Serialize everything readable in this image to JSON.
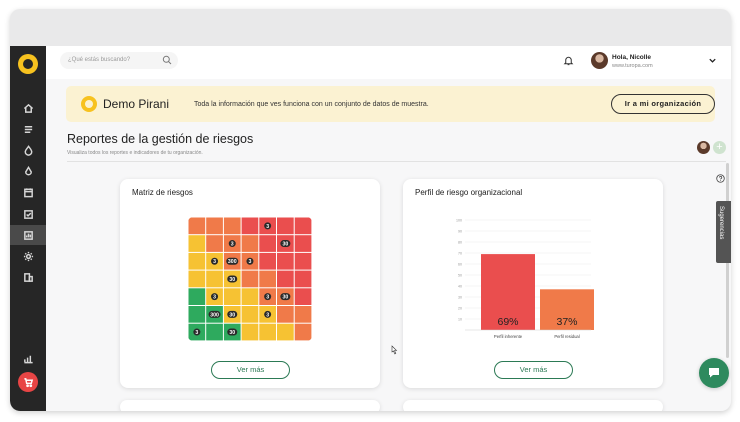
{
  "sidebar": {
    "items": [
      "home-icon",
      "list-icon",
      "flame-icon",
      "drop-icon",
      "calendar-icon",
      "check-icon",
      "reports-icon",
      "gear-icon",
      "building-icon"
    ],
    "bottom": [
      "chart-growth-icon",
      "cart-icon"
    ]
  },
  "search": {
    "placeholder": "¿Qué estás buscando?"
  },
  "user": {
    "greeting": "Hola, Nicolle",
    "site": "www.turopa.com"
  },
  "banner": {
    "name": "Demo Pirani",
    "message": "Toda la información que ves funciona con un conjunto de datos de muestra.",
    "button": "Ir a mi organización"
  },
  "page": {
    "title": "Reportes de la gestión de riesgos",
    "subtitle": "Visualiza todos los reportes e indicadores de tu organización."
  },
  "cards": {
    "matrix": {
      "title": "Matriz de riesgos",
      "button": "Ver más"
    },
    "profile": {
      "title": "Perfil de riesgo organizacional",
      "button": "Ver más"
    }
  },
  "side_tab": {
    "label": "Sugerencias"
  },
  "colors": {
    "green": "#2eaa5e",
    "yellow": "#f6c233",
    "orange": "#f07a49",
    "red": "#ea4e4e",
    "accent": "#2c7a55"
  },
  "matrix": {
    "rows": [
      [
        "orange",
        "orange",
        "orange",
        "red",
        "red",
        "red",
        "red"
      ],
      [
        "yellow",
        "orange",
        "orange",
        "orange",
        "red",
        "red",
        "red"
      ],
      [
        "yellow",
        "yellow",
        "orange",
        "orange",
        "red",
        "red",
        "red"
      ],
      [
        "yellow",
        "yellow",
        "yellow",
        "orange",
        "orange",
        "red",
        "red"
      ],
      [
        "green",
        "yellow",
        "yellow",
        "yellow",
        "orange",
        "orange",
        "red"
      ],
      [
        "green",
        "green",
        "yellow",
        "yellow",
        "yellow",
        "orange",
        "orange"
      ],
      [
        "green",
        "green",
        "green",
        "yellow",
        "yellow",
        "yellow",
        "orange"
      ]
    ],
    "badges": [
      {
        "r": 0,
        "c": 4,
        "t": "3"
      },
      {
        "r": 1,
        "c": 2,
        "t": "3"
      },
      {
        "r": 1,
        "c": 5,
        "t": "30"
      },
      {
        "r": 2,
        "c": 1,
        "t": "3"
      },
      {
        "r": 2,
        "c": 2,
        "t": "300"
      },
      {
        "r": 2,
        "c": 3,
        "t": "3"
      },
      {
        "r": 3,
        "c": 2,
        "t": "30"
      },
      {
        "r": 4,
        "c": 1,
        "t": "3"
      },
      {
        "r": 4,
        "c": 4,
        "t": "3"
      },
      {
        "r": 4,
        "c": 5,
        "t": "30"
      },
      {
        "r": 5,
        "c": 1,
        "t": "300"
      },
      {
        "r": 5,
        "c": 2,
        "t": "30"
      },
      {
        "r": 5,
        "c": 4,
        "t": "3"
      },
      {
        "r": 6,
        "c": 0,
        "t": "3"
      },
      {
        "r": 6,
        "c": 2,
        "t": "30"
      }
    ]
  },
  "chart_data": {
    "type": "bar",
    "categories": [
      "Perfil inherente",
      "Perfil residual"
    ],
    "values": [
      69,
      37
    ],
    "data_labels": [
      "69%",
      "37%"
    ],
    "colors": [
      "#ea4e4e",
      "#f07a49"
    ],
    "ylim": [
      0,
      100
    ],
    "yticks": [
      "10",
      "20",
      "30",
      "40",
      "50",
      "60",
      "70",
      "80",
      "90",
      "100"
    ]
  }
}
